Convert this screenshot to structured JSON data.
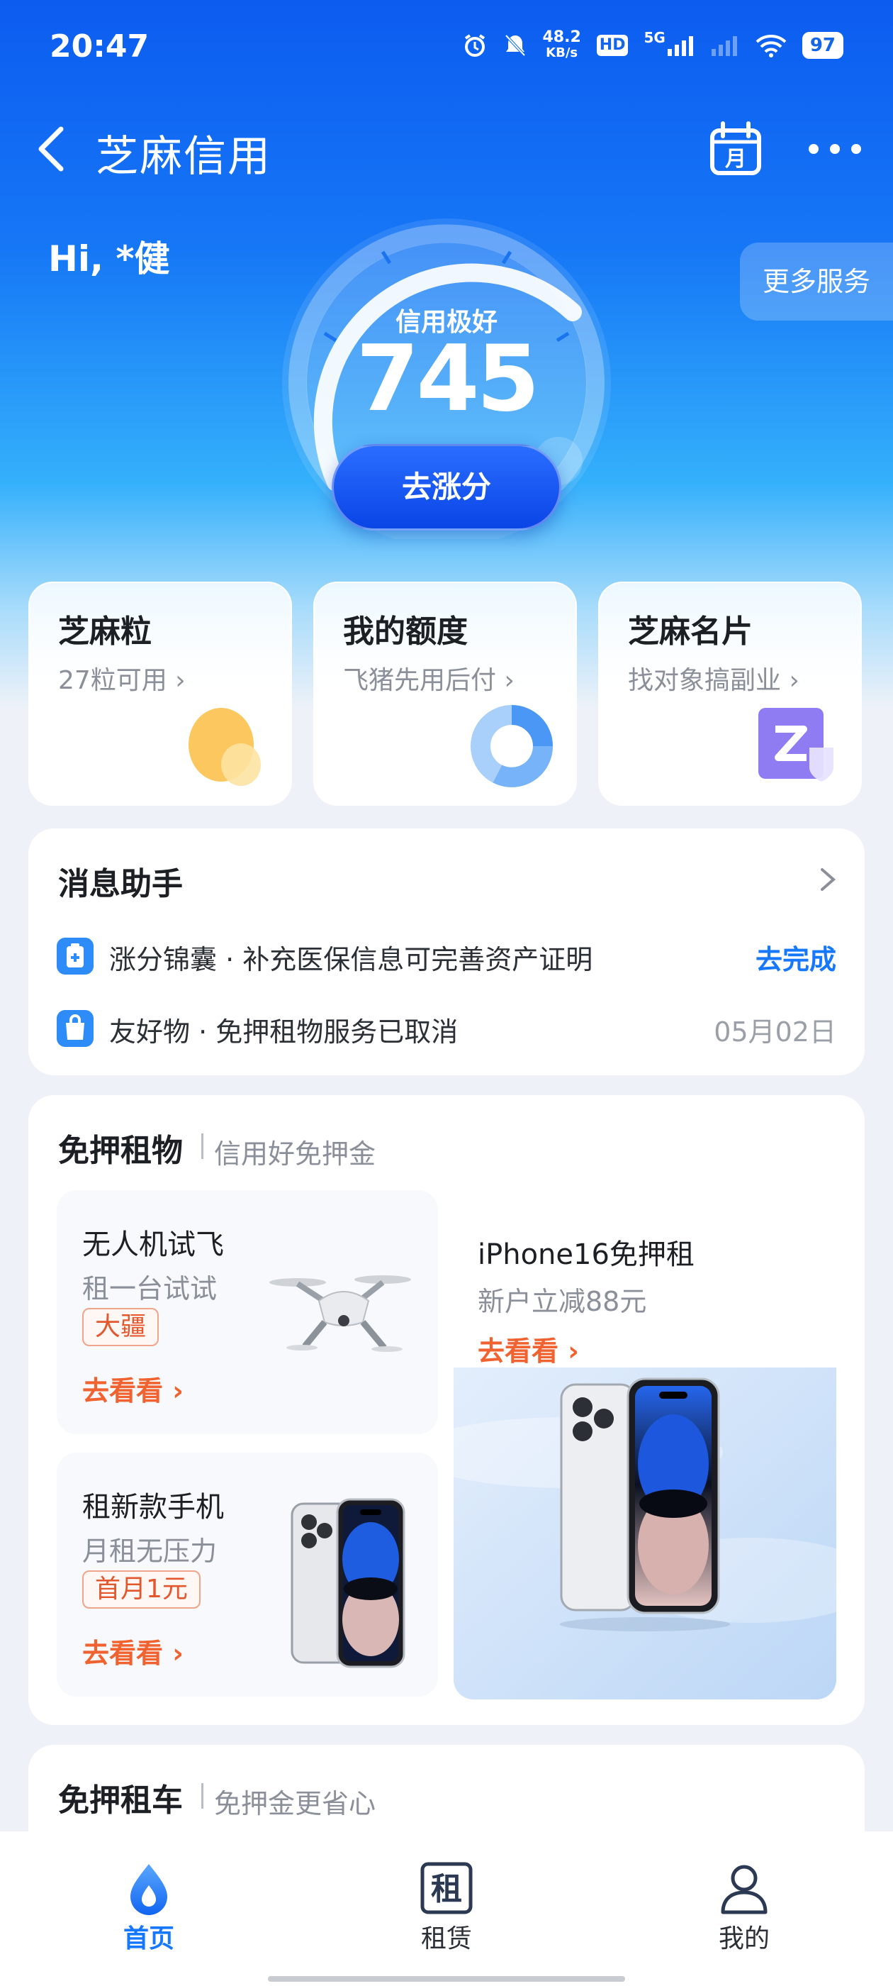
{
  "status_bar": {
    "time": "20:47",
    "net_speed_value": "48.2",
    "net_speed_unit": "KB/s",
    "hd_label": "HD",
    "signal_label": "5G",
    "battery": "97"
  },
  "nav": {
    "title": "芝麻信用"
  },
  "hero": {
    "greeting": "Hi, *健",
    "more_services": "更多服务",
    "score_label": "信用极好",
    "score": "745",
    "boost_button": "去涨分"
  },
  "quick_cards": [
    {
      "title": "芝麻粒",
      "subtitle": "27粒可用 ›"
    },
    {
      "title": "我的额度",
      "subtitle": "飞猪先用后付 ›"
    },
    {
      "title": "芝麻名片",
      "subtitle": "找对象搞副业 ›"
    }
  ],
  "messages": {
    "title": "消息助手",
    "items": [
      {
        "text": "涨分锦囊 · 补充医保信息可完善资产证明",
        "action": "去完成"
      },
      {
        "text": "友好物 · 免押租物服务已取消",
        "date": "05月02日"
      }
    ]
  },
  "rental": {
    "title": "免押租物",
    "subtitle": "信用好免押金",
    "tiles": [
      {
        "title": "无人机试飞",
        "subtitle": "租一台试试",
        "tag": "大疆",
        "link": "去看看 ›"
      },
      {
        "title": "租新款手机",
        "subtitle": "月租无压力",
        "tag": "首月1元",
        "link": "去看看 ›"
      }
    ],
    "feature": {
      "title": "iPhone16免押租",
      "subtitle": "新户立减88元",
      "link": "去看看 ›"
    }
  },
  "car": {
    "title": "免押租车",
    "subtitle": "免押金更省心"
  },
  "tabbar": [
    {
      "label": "首页",
      "icon": "home-drop-icon",
      "active": true
    },
    {
      "label": "租赁",
      "icon": "rent-icon",
      "active": false
    },
    {
      "label": "我的",
      "icon": "user-icon",
      "active": false
    }
  ],
  "colors": {
    "primary": "#1677ff",
    "accent_orange": "#f0622f",
    "hero_blue": "#0c5cf0"
  }
}
